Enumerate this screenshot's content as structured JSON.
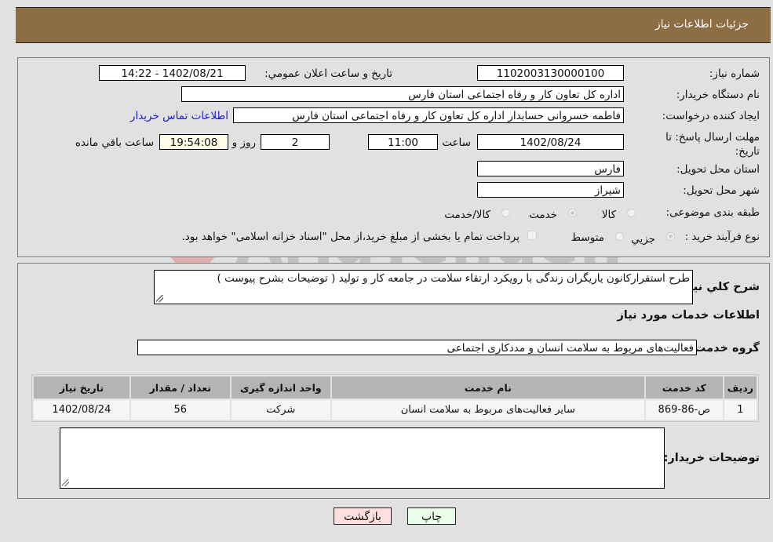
{
  "header": {
    "title": "جزئیات اطلاعات نیاز"
  },
  "form": {
    "need_number": {
      "label": "شماره نیاز:",
      "value": "1102003130000100"
    },
    "announce_datetime": {
      "label": "تاریخ و ساعت اعلان عمومي:",
      "value": "1402/08/21 - 14:22"
    },
    "buyer_org": {
      "label": "نام دستگاه خریدار:",
      "value": "اداره کل تعاون  کار و رفاه اجتماعی استان فارس"
    },
    "creator": {
      "label": "ایجاد کننده درخواست:",
      "value": "فاطمه خسروانی حسابدار اداره کل تعاون  کار و رفاه اجتماعی استان فارس"
    },
    "buyer_contact_link": "اطلاعات تماس خریدار",
    "deadline": {
      "label": "مهلت ارسال پاسخ: تا تاریخ:",
      "date": "1402/08/24",
      "time_label": "ساعت",
      "time": "11:00",
      "days": "2",
      "days_label": "روز و",
      "remaining": "19:54:08",
      "remaining_label": "ساعت باقي مانده"
    },
    "province": {
      "label": "استان محل تحویل:",
      "value": "فارس"
    },
    "city": {
      "label": "شهر محل تحویل:",
      "value": "شیراز"
    },
    "category": {
      "label": "طبقه بندی موضوعی:",
      "options": [
        "کالا",
        "خدمت",
        "کالا/خدمت"
      ],
      "selected": "خدمت"
    },
    "purchase_process": {
      "label": "نوع فرآیند خرید :",
      "options": [
        "جزیي",
        "متوسط"
      ],
      "selected": "جزیي",
      "treasury_checkbox_label": "پرداخت تمام یا بخشی از مبلغ خرید،از محل \"اسناد خزانه اسلامی\" خواهد بود.",
      "treasury_checked": false
    }
  },
  "details": {
    "description": {
      "label": "شرح کلي نیاز:",
      "value": "طرح استقرارکانون یاریگران زندگی با رویکرد ارتقاء سلامت  در جامعه کار و تولید ( توضیحات بشرح پیوست )"
    },
    "services_heading": "اطلاعات خدمات مورد نیاز",
    "service_group": {
      "label": "گروه خدمت:",
      "value": "فعالیت‌های مربوط به سلامت انسان و مددکاری اجتماعی"
    },
    "table": {
      "headers": [
        "ردیف",
        "کد خدمت",
        "نام خدمت",
        "واحد اندازه گیری",
        "تعداد / مقدار",
        "تاریخ نیاز"
      ],
      "rows": [
        [
          "1",
          "ص-86-869",
          "سایر فعالیت‌های مربوط به سلامت انسان",
          "شرکت",
          "56",
          "1402/08/24"
        ]
      ]
    },
    "buyer_notes": {
      "label": "توضیحات خریدار:",
      "value": ""
    }
  },
  "buttons": {
    "print": "چاپ",
    "back": "بازگشت"
  },
  "watermark": "AriaTender.neT",
  "colors": {
    "header_bg": "#8c6d44",
    "print_bg": "#eaffea",
    "back_bg": "#ffdede",
    "link": "#1a1acc"
  }
}
